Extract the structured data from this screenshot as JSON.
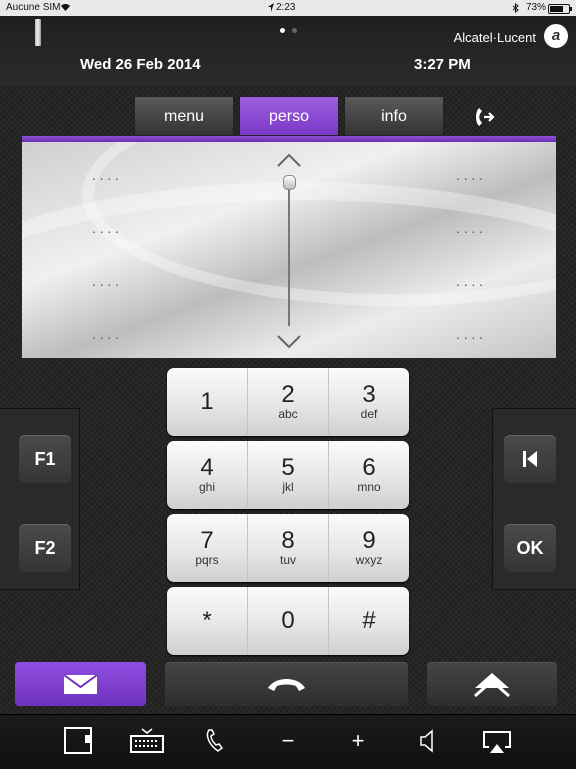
{
  "status_bar": {
    "carrier": "Aucune SIM",
    "time": "2:23",
    "battery": "73%"
  },
  "header": {
    "date": "Wed 26 Feb 2014",
    "time": "3:27 PM",
    "brand": "Alcatel·Lucent",
    "logo": "a",
    "pages": 2,
    "active_page": 0
  },
  "tabs": [
    {
      "label": "menu",
      "active": false
    },
    {
      "label": "perso",
      "active": true
    },
    {
      "label": "info",
      "active": false
    }
  ],
  "perso": {
    "slot_placeholder": "····",
    "slots_per_column": 4
  },
  "keypad": [
    [
      {
        "num": "1",
        "letters": ""
      },
      {
        "num": "2",
        "letters": "abc"
      },
      {
        "num": "3",
        "letters": "def"
      }
    ],
    [
      {
        "num": "4",
        "letters": "ghi"
      },
      {
        "num": "5",
        "letters": "jkl"
      },
      {
        "num": "6",
        "letters": "mno"
      }
    ],
    [
      {
        "num": "7",
        "letters": "pqrs"
      },
      {
        "num": "8",
        "letters": "tuv"
      },
      {
        "num": "9",
        "letters": "wxyz"
      }
    ],
    [
      {
        "num": "*",
        "letters": ""
      },
      {
        "num": "0",
        "letters": ""
      },
      {
        "num": "#",
        "letters": ""
      }
    ]
  ],
  "side_keys": {
    "f1": "F1",
    "f2": "F2",
    "ok": "OK",
    "skip_icon": "skip-back-icon"
  },
  "toolbar": {
    "minus": "−",
    "plus": "+"
  },
  "colors": {
    "accent": "#7a38c6",
    "panel": "#e0e0e0",
    "background": "#262626"
  }
}
